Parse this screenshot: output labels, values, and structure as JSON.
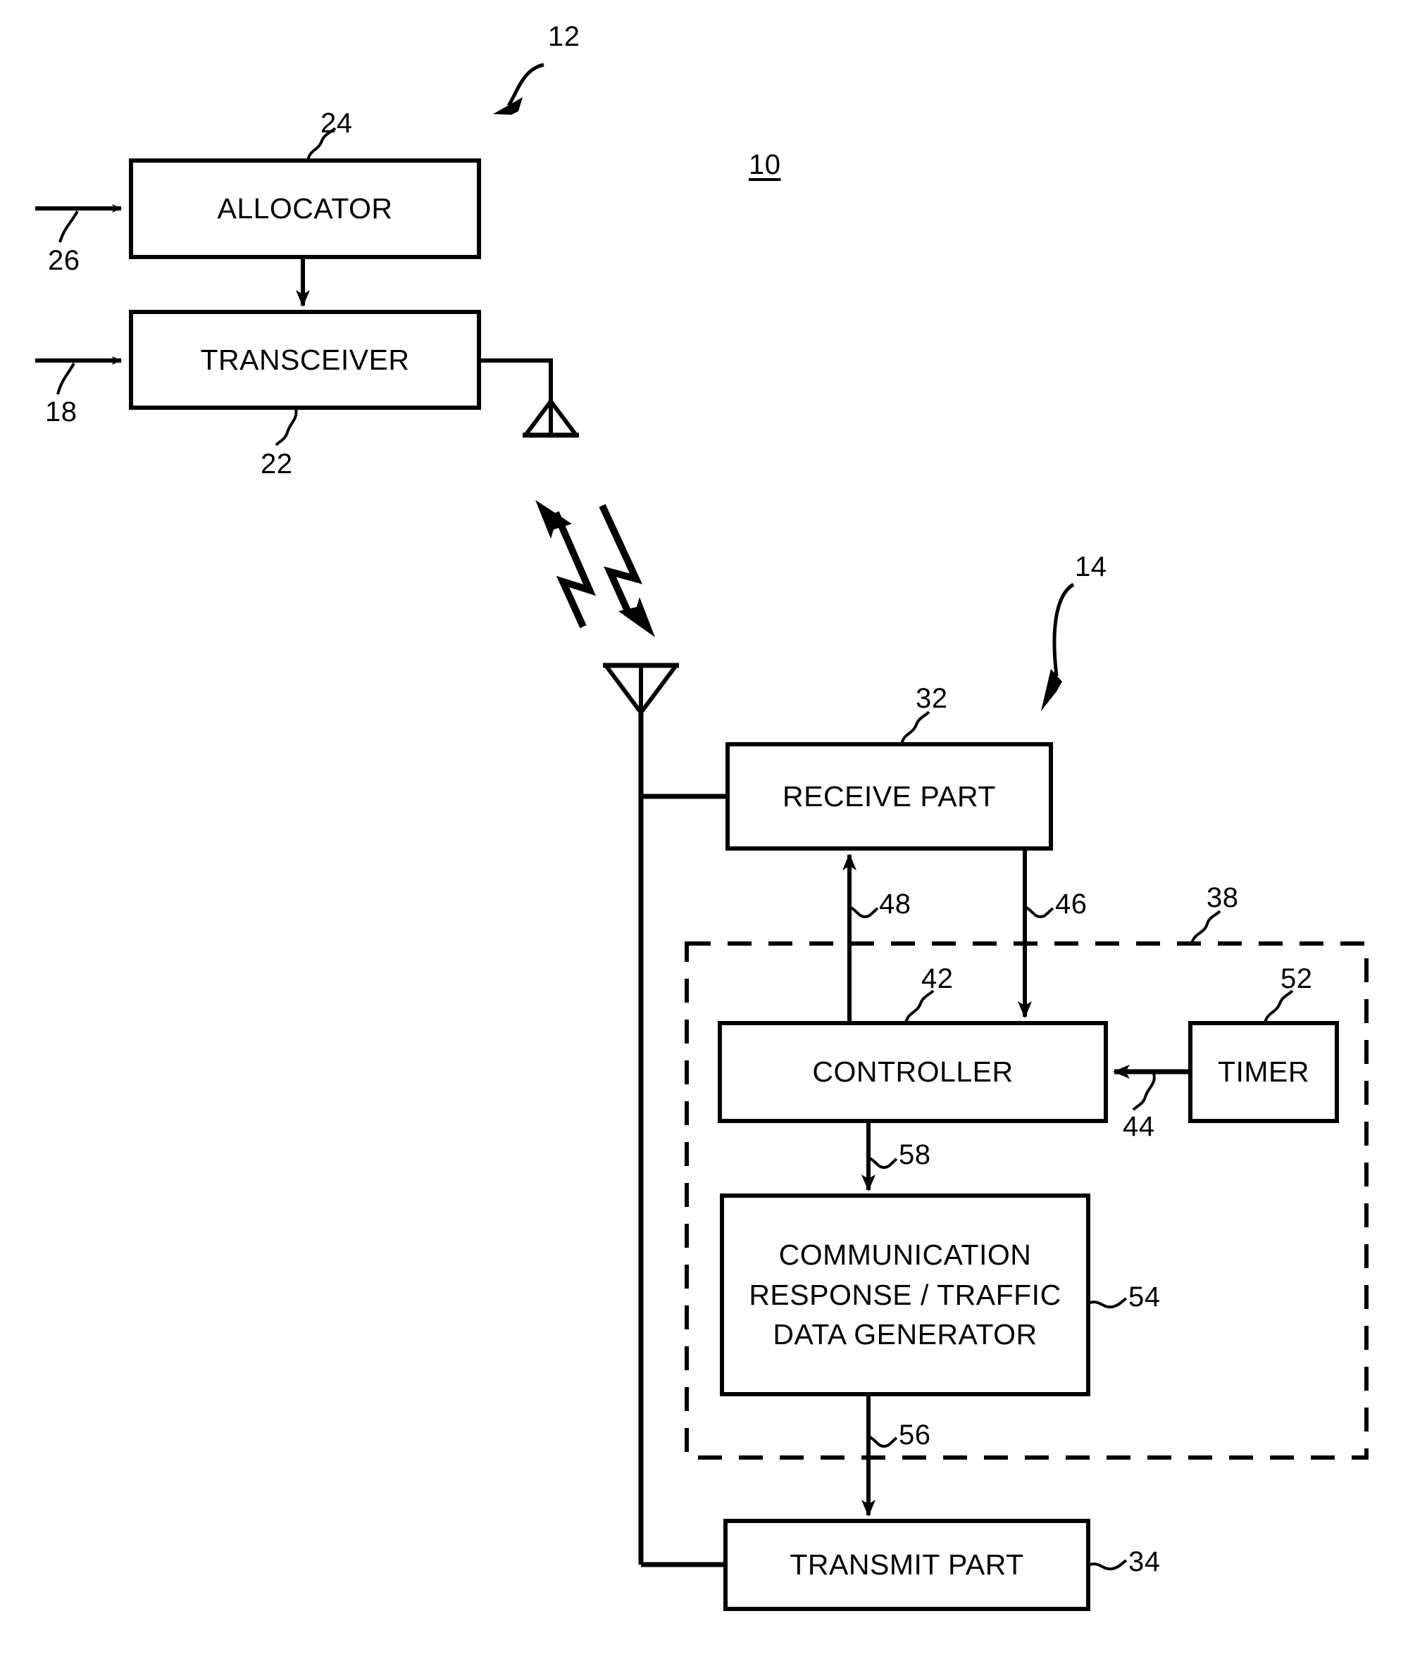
{
  "figure": {
    "title_ref": "10",
    "type": "patent-block-diagram",
    "description": "Wireless communication system block diagram with base station (12) and mobile station (14)"
  },
  "groups": {
    "system": {
      "ref": "10"
    },
    "base_station": {
      "ref": "12"
    },
    "mobile_station": {
      "ref": "14"
    },
    "dashed_enclosure": {
      "ref": "38"
    }
  },
  "blocks": [
    {
      "id": "allocator",
      "label": "ALLOCATOR",
      "ref": "24"
    },
    {
      "id": "transceiver",
      "label": "TRANSCEIVER",
      "ref": "22"
    },
    {
      "id": "receive_part",
      "label": "RECEIVE PART",
      "ref": "32"
    },
    {
      "id": "controller",
      "label": "CONTROLLER",
      "ref": "42"
    },
    {
      "id": "timer",
      "label": "TIMER",
      "ref": "52"
    },
    {
      "id": "comm_gen",
      "label_line1": "COMMUNICATION",
      "label_line2": "RESPONSE / TRAFFIC",
      "label_line3": "DATA GENERATOR",
      "ref": "54"
    },
    {
      "id": "transmit_part",
      "label": "TRANSMIT PART",
      "ref": "34"
    }
  ],
  "signals": [
    {
      "id": "in_allocator",
      "ref": "26"
    },
    {
      "id": "in_transceiver",
      "ref": "18"
    },
    {
      "id": "rx_to_ctrl",
      "ref": "46"
    },
    {
      "id": "ctrl_to_rx",
      "ref": "48"
    },
    {
      "id": "timer_to_ctrl",
      "ref": "44"
    },
    {
      "id": "ctrl_to_gen",
      "ref": "58"
    },
    {
      "id": "gen_to_tx",
      "ref": "56"
    }
  ],
  "icons": {
    "base_antenna": "antenna-icon",
    "mobile_antenna": "antenna-icon",
    "rf_link_up": "lightning-bolt-arrow-icon",
    "rf_link_down": "lightning-bolt-arrow-icon"
  },
  "colors": {
    "ink": "#000000",
    "paper": "#ffffff"
  }
}
